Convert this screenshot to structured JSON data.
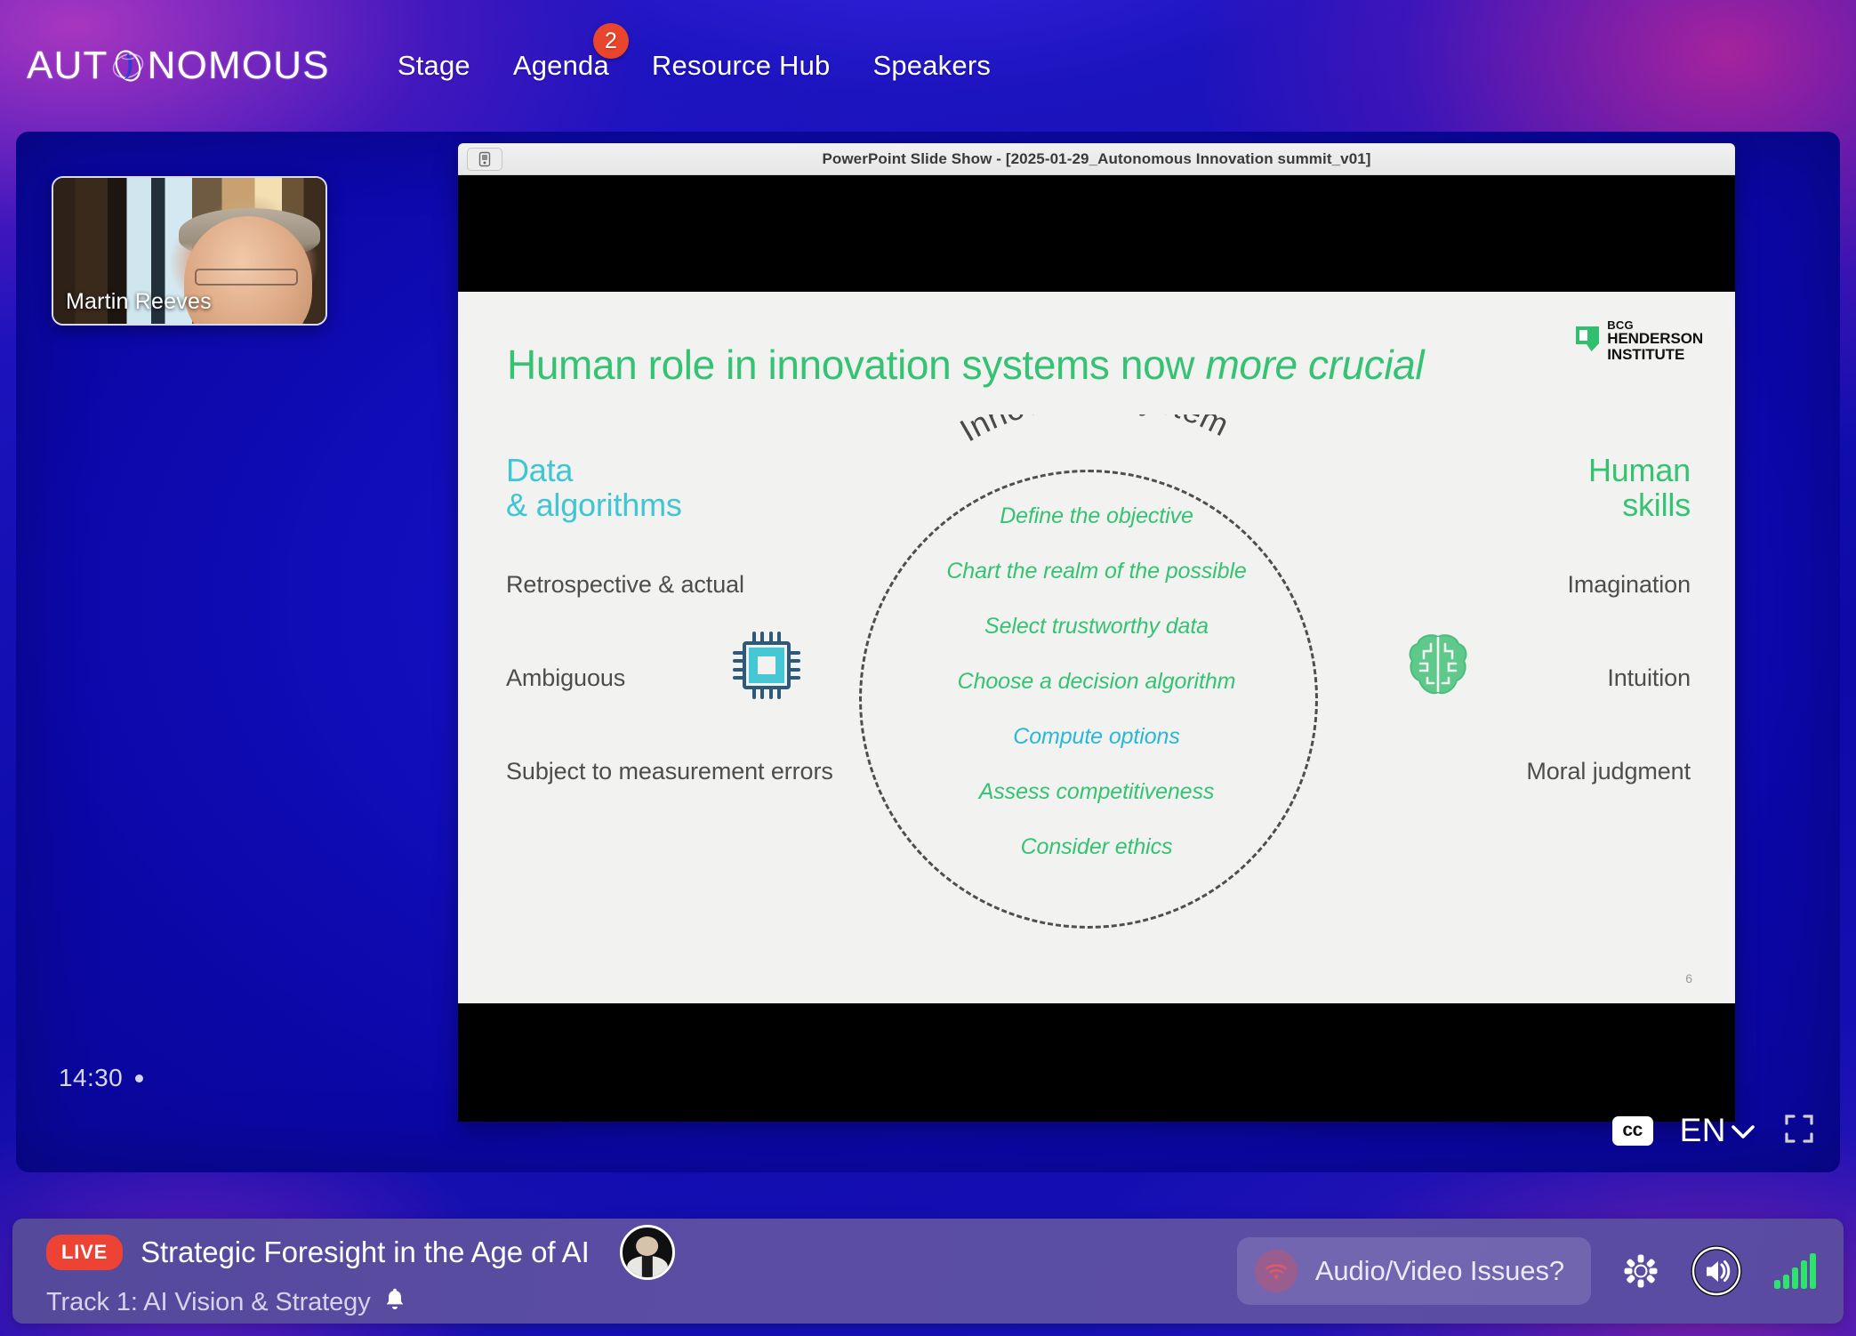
{
  "header": {
    "logo_text_before": "AUT",
    "logo_icon": "globe-icon",
    "logo_text_after": "NOMOUS",
    "nav": [
      {
        "label": "Stage",
        "badge": null
      },
      {
        "label": "Agenda",
        "badge": "2"
      },
      {
        "label": "Resource Hub",
        "badge": null
      },
      {
        "label": "Speakers",
        "badge": null
      }
    ]
  },
  "stage": {
    "speaker_thumb": {
      "name": "Martin Reeves"
    },
    "timecode": "14:30",
    "player": {
      "cc_label": "cc",
      "language": "EN",
      "chevron_icon": "chevron-down-icon",
      "fullscreen_icon": "fullscreen-icon"
    }
  },
  "share": {
    "titlebar": "PowerPoint Slide Show - [2025-01-29_Autonomous Innovation summit_v01]",
    "titlebar_icon": "screen-share-icon"
  },
  "slide": {
    "logo": {
      "line1": "BCG",
      "line2": "HENDERSON",
      "line3": "INSTITUTE",
      "mark": "bcg-mark-icon"
    },
    "title_main": "Human role in innovation systems now ",
    "title_italic": "more crucial",
    "page_number": "6",
    "left_column": {
      "heading_line1": "Data",
      "heading_line2": "& algorithms",
      "icon": "chip-icon",
      "items": [
        "Retrospective & actual",
        "Ambiguous",
        "Subject to measurement errors"
      ]
    },
    "right_column": {
      "heading_line1": "Human",
      "heading_line2": "skills",
      "icon": "brain-icon",
      "items": [
        "Imagination",
        "Intuition",
        "Moral judgment"
      ]
    },
    "center": {
      "arc_label": "Innovation system",
      "steps": [
        {
          "label": "Define the objective",
          "accent": false
        },
        {
          "label": "Chart the realm of the possible",
          "accent": false
        },
        {
          "label": "Select trustworthy data",
          "accent": false
        },
        {
          "label": "Choose a decision algorithm",
          "accent": false
        },
        {
          "label": "Compute options",
          "accent": true
        },
        {
          "label": "Assess competitiveness",
          "accent": false
        },
        {
          "label": "Consider ethics",
          "accent": false
        }
      ]
    },
    "colors": {
      "green": "#35c373",
      "cyan": "#3fc5d4",
      "accent_blue": "#29b8d8",
      "body_gray": "#4d4d4d",
      "slide_bg": "#f2f2f1"
    }
  },
  "bottom_bar": {
    "live_label": "LIVE",
    "session_title": "Strategic Foresight in the Age of AI",
    "track_label": "Track 1: AI Vision & Strategy",
    "bell_icon": "bell-icon",
    "avatar": "speaker-avatar",
    "av_button_label": "Audio/Video Issues?",
    "av_button_icon": "wifi-icon",
    "settings_icon": "gear-icon",
    "volume_icon": "speaker-volume-icon",
    "signal_icon": "signal-bars-icon",
    "colors": {
      "live_red": "#ec4335",
      "bar_purple": "#5a4da3",
      "signal_green": "#2ee36a"
    }
  }
}
